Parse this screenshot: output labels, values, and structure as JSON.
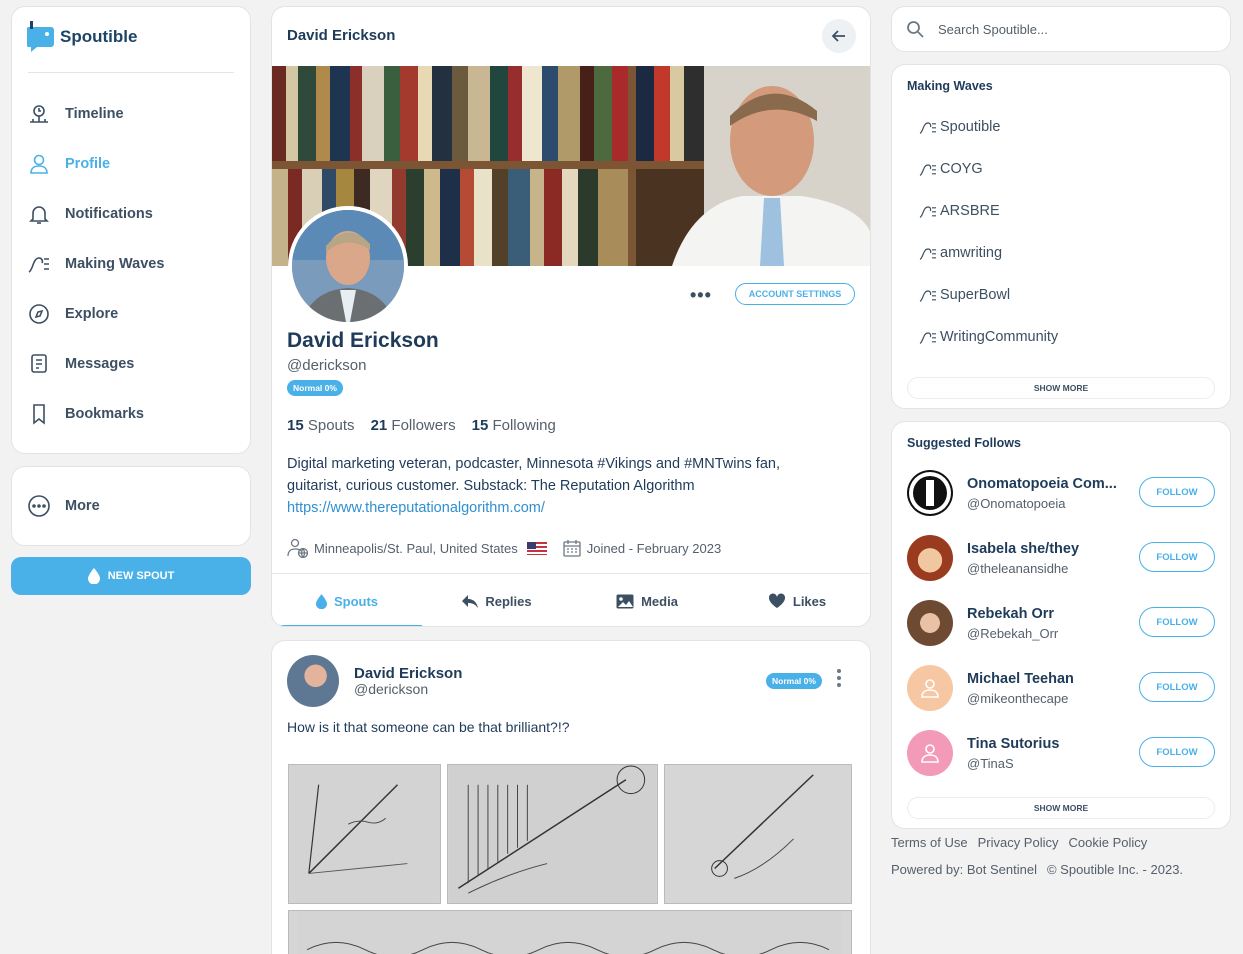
{
  "brand": {
    "name": "Spoutible",
    "accent": "#4ab0e8",
    "text": "#1f3b5a"
  },
  "nav": {
    "items": [
      {
        "label": "Timeline",
        "icon": "timeline-icon"
      },
      {
        "label": "Profile",
        "icon": "profile-icon"
      },
      {
        "label": "Notifications",
        "icon": "bell-icon"
      },
      {
        "label": "Making Waves",
        "icon": "wave-icon"
      },
      {
        "label": "Explore",
        "icon": "compass-icon"
      },
      {
        "label": "Messages",
        "icon": "message-icon"
      },
      {
        "label": "Bookmarks",
        "icon": "bookmark-icon"
      }
    ],
    "active": "Profile",
    "more_label": "More",
    "new_spout_label": "NEW SPOUT"
  },
  "profile": {
    "header_name": "David Erickson",
    "name": "David Erickson",
    "handle": "@derickson",
    "badge": "Normal 0%",
    "account_settings_label": "ACCOUNT SETTINGS",
    "stats": {
      "spouts_count": "15",
      "spouts_label": "Spouts",
      "followers_count": "21",
      "followers_label": "Followers",
      "following_count": "15",
      "following_label": "Following"
    },
    "bio_line1": "Digital marketing veteran, podcaster, Minnesota #Vikings and #MNTwins fan,",
    "bio_line2": "guitarist, curious customer. Substack: The Reputation Algorithm",
    "link": "https://www.thereputationalgorithm.com/",
    "location": "Minneapolis/St. Paul, United States",
    "joined": "Joined - February 2023",
    "tabs": [
      "Spouts",
      "Replies",
      "Media",
      "Likes"
    ],
    "active_tab": "Spouts"
  },
  "post": {
    "name": "David Erickson",
    "handle": "@derickson",
    "badge": "Normal 0%",
    "text": "How is it that someone can be that brilliant?!?"
  },
  "search": {
    "placeholder": "Search Spoutible..."
  },
  "waves": {
    "title": "Making Waves",
    "items": [
      "Spoutible",
      "COYG",
      "ARSBRE",
      "amwriting",
      "SuperBowl",
      "WritingCommunity"
    ],
    "show_more": "SHOW MORE"
  },
  "follows": {
    "title": "Suggested Follows",
    "follow_label": "FOLLOW",
    "show_more": "SHOW MORE",
    "items": [
      {
        "name": "Onomatopoeia Com...",
        "handle": "@Onomatopoeia"
      },
      {
        "name": "Isabela she/they",
        "handle": "@theleanansidhe"
      },
      {
        "name": "Rebekah Orr",
        "handle": "@Rebekah_Orr"
      },
      {
        "name": "Michael Teehan",
        "handle": "@mikeonthecape"
      },
      {
        "name": "Tina Sutorius",
        "handle": "@TinaS"
      }
    ]
  },
  "footer": {
    "terms": "Terms of Use",
    "privacy": "Privacy Policy",
    "cookie": "Cookie Policy",
    "powered": "Powered by: Bot Sentinel",
    "copyright": "© Spoutible Inc. - 2023."
  }
}
